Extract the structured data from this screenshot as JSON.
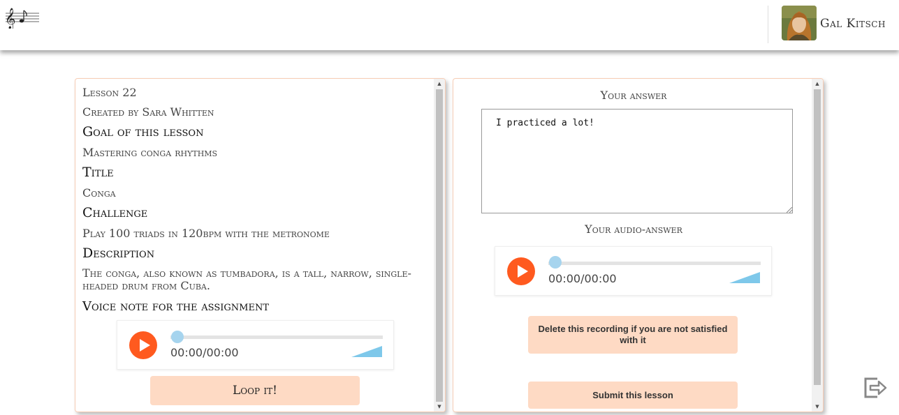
{
  "header": {
    "logo_icon": "music-note-logo-icon",
    "username": "Gal Kitsch",
    "avatar_icon": "user-avatar-icon"
  },
  "lesson": {
    "number": "Lesson 22",
    "created_by": "Created by Sara Whitten",
    "goal_heading": "Goal of this lesson",
    "goal": "Mastering conga rhythms",
    "title_heading": "Title",
    "title": "Conga",
    "challenge_heading": "Challenge",
    "challenge": "Play 100 triads in 120bpm with the metronome",
    "description_heading": "Description",
    "description": "The conga, also known as tumbadora, is a tall, narrow, single-headed drum from Cuba.",
    "voice_note_heading": "Voice note for the assignment",
    "voice_player": {
      "time": "00:00/00:00",
      "progress": 0
    },
    "loop_button": "Loop it!"
  },
  "answer": {
    "answer_label": "Your answer",
    "answer_text": "I practiced a lot!",
    "audio_label": "Your audio-answer",
    "audio_player": {
      "time": "00:00/00:00",
      "progress": 0
    },
    "delete_button": "Delete this recording if you are not satisfied with it",
    "submit_button": "Submit this lesson"
  },
  "colors": {
    "accent_orange": "#ff5a1f",
    "button_bg": "#fedac4",
    "panel_border": "#f7cdb5",
    "slider_knob": "#a6d4ee",
    "volume": "#7ec8ea"
  },
  "footer": {
    "exit_icon": "logout-icon"
  }
}
